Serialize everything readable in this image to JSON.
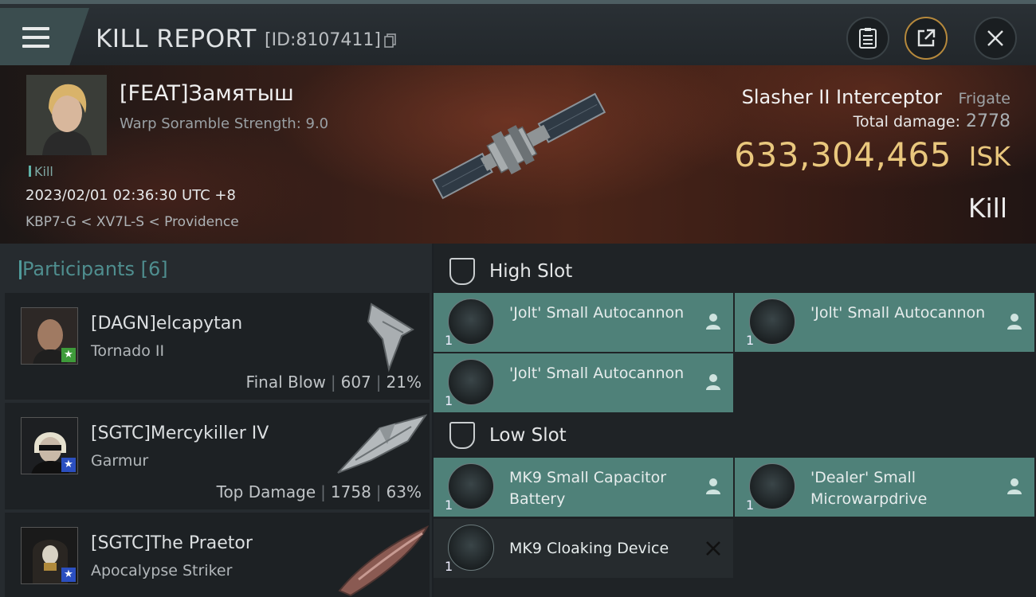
{
  "header": {
    "title": "KILL REPORT",
    "report_id": "[ID:8107411]"
  },
  "victim": {
    "name": "[FEAT]Замятыш",
    "subtitle": "Warp Soramble Strength: 9.0",
    "tag": "Kill",
    "datetime": "2023/02/01 02:36:30 UTC +8",
    "location": "KBP7-G < XV7L-S < Providence",
    "ship_name": "Slasher II Interceptor",
    "ship_class": "Frigate",
    "damage_label": "Total damage:",
    "damage_value": "2778",
    "isk_value": "633,304,465",
    "isk_unit": "ISK",
    "result": "Kill"
  },
  "participants": {
    "label": "Participants",
    "count": "[6]",
    "items": [
      {
        "name": "[DAGN]elcapytan",
        "ship": "Tornado II",
        "role": "Final Blow",
        "damage": "607",
        "percent": "21%",
        "badge": "★"
      },
      {
        "name": "[SGTC]Mercykiller IV",
        "ship": "Garmur",
        "role": "Top Damage",
        "damage": "1758",
        "percent": "63%",
        "badge": "★"
      },
      {
        "name": "[SGTC]The Praetor",
        "ship": "Apocalypse Striker",
        "badge": "★"
      }
    ]
  },
  "fitting": {
    "high_slot_label": "High Slot",
    "low_slot_label": "Low Slot",
    "high": [
      {
        "name": "'Jolt' Small Autocannon",
        "qty": "1"
      },
      {
        "name": "'Jolt' Small Autocannon",
        "qty": "1"
      },
      {
        "name": "'Jolt' Small Autocannon",
        "qty": "1"
      }
    ],
    "low": [
      {
        "name": "MK9 Small Capacitor Battery",
        "qty": "1"
      },
      {
        "name": "'Dealer' Small Microwarpdrive",
        "qty": "1"
      },
      {
        "name": "MK9 Cloaking Device",
        "qty": "1"
      }
    ]
  },
  "colors": {
    "accent_teal": "#4f8179",
    "isk_gold": "#e9c77d"
  }
}
